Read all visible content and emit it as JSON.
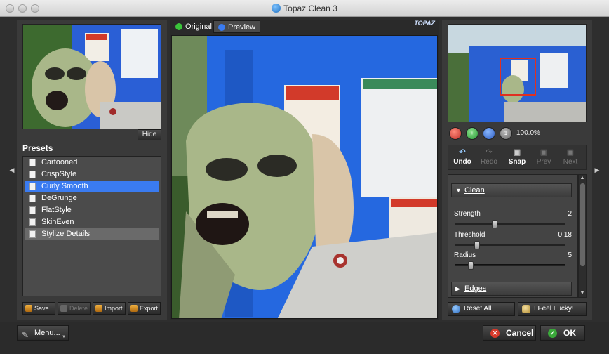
{
  "window": {
    "title": "Topaz Clean 3"
  },
  "colors": {
    "accent": "#3a7bf0",
    "cancel": "#d93a2b",
    "ok": "#3aa83a"
  },
  "left": {
    "hide_label": "Hide",
    "presets_title": "Presets",
    "presets": [
      {
        "label": "Cartooned",
        "state": "normal"
      },
      {
        "label": "CrispStyle",
        "state": "normal"
      },
      {
        "label": "Curly Smooth",
        "state": "selected"
      },
      {
        "label": "DeGrunge",
        "state": "normal"
      },
      {
        "label": "FlatStyle",
        "state": "normal"
      },
      {
        "label": "SkinEven",
        "state": "normal"
      },
      {
        "label": "Stylize Details",
        "state": "dim"
      }
    ],
    "buttons": {
      "save": "Save",
      "delete": "Delete",
      "import": "Import",
      "export": "Export"
    }
  },
  "center": {
    "tabs": {
      "original": "Original",
      "preview": "Preview"
    },
    "logo": "TOPAZ"
  },
  "right": {
    "zoom": "100.0%",
    "history": {
      "undo": "Undo",
      "redo": "Redo",
      "snap": "Snap",
      "prev": "Prev",
      "next": "Next"
    },
    "clean_section": "Clean",
    "edges_section": "Edges",
    "sliders": [
      {
        "label": "Strength",
        "value": "2",
        "fraction": 0.35
      },
      {
        "label": "Threshold",
        "value": "0.18",
        "fraction": 0.18
      },
      {
        "label": "Radius",
        "value": "5",
        "fraction": 0.12
      }
    ],
    "reset_all": "Reset All",
    "feel_lucky": "I Feel Lucky!"
  },
  "bottom": {
    "menu": "Menu...",
    "cancel": "Cancel",
    "ok": "OK"
  }
}
